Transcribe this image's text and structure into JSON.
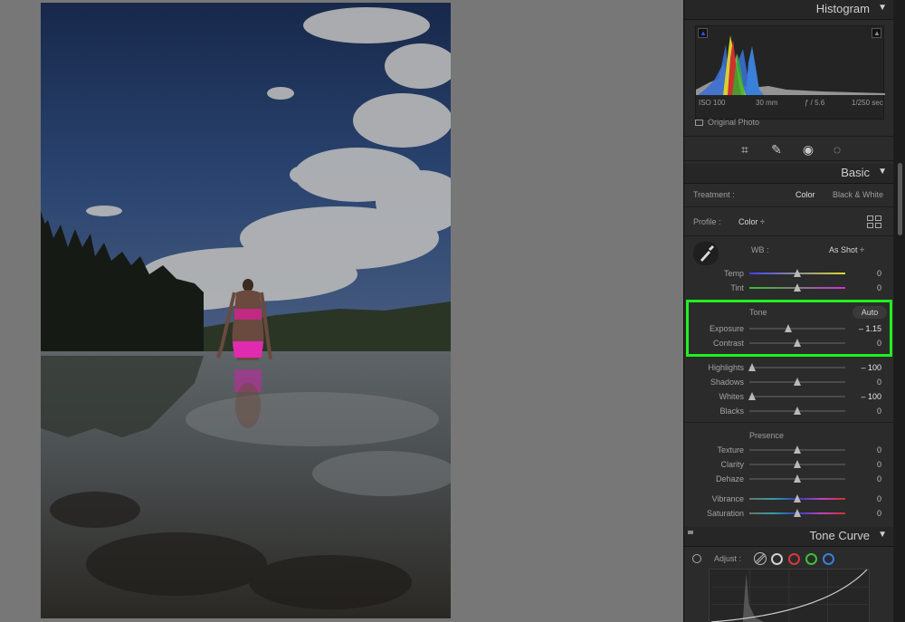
{
  "histogram": {
    "title": "Histogram",
    "iso": "ISO 100",
    "focal_length": "30 mm",
    "aperture": "ƒ / 5.6",
    "shutter": "1/250 sec",
    "original_photo_label": "Original Photo"
  },
  "basic": {
    "title": "Basic",
    "treatment_label": "Treatment :",
    "treatment_color": "Color",
    "treatment_bw": "Black & White",
    "profile_label": "Profile :",
    "profile_value": "Color ÷",
    "wb_label": "WB :",
    "wb_value": "As Shot ÷",
    "temp_label": "Temp",
    "temp_value": "0",
    "tint_label": "Tint",
    "tint_value": "0",
    "tone_label": "Tone",
    "auto_label": "Auto",
    "exposure_label": "Exposure",
    "exposure_value": "– 1.15",
    "exposure_level": 0.405,
    "contrast_label": "Contrast",
    "contrast_value": "0",
    "highlights_label": "Highlights",
    "highlights_value": "– 100",
    "shadows_label": "Shadows",
    "shadows_value": "0",
    "whites_label": "Whites",
    "whites_value": "– 100",
    "blacks_label": "Blacks",
    "blacks_value": "0",
    "presence_label": "Presence",
    "texture_label": "Texture",
    "texture_value": "0",
    "clarity_label": "Clarity",
    "clarity_value": "0",
    "dehaze_label": "Dehaze",
    "dehaze_value": "0",
    "vibrance_label": "Vibrance",
    "vibrance_value": "0",
    "saturation_label": "Saturation",
    "saturation_value": "0"
  },
  "tone_curve": {
    "title": "Tone Curve",
    "adjust_label": "Adjust :"
  },
  "colors": {
    "highlight_box": "#1ff01f",
    "panel_bg": "#2b2b2b",
    "canvas_bg": "#777777"
  }
}
